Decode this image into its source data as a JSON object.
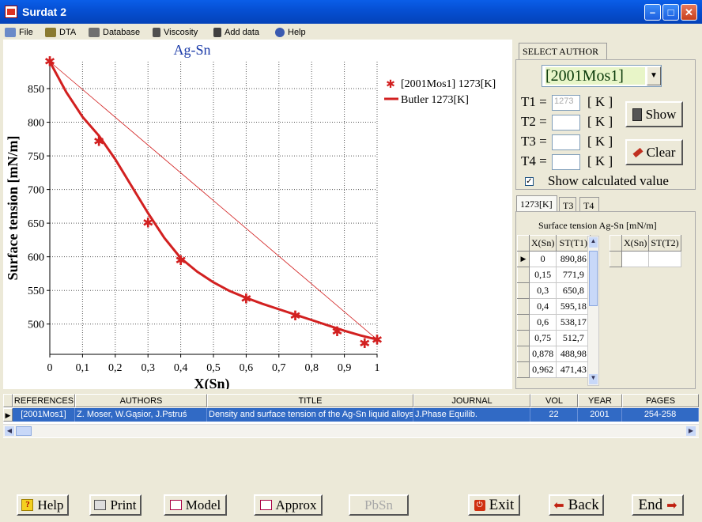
{
  "window": {
    "title": "Surdat 2"
  },
  "menu": [
    "File",
    "DTA",
    "Database",
    "Viscosity",
    "Add data",
    "Help"
  ],
  "chart_data": {
    "type": "line",
    "title": "Ag-Sn",
    "xlabel": "X(Sn)",
    "ylabel": "Surface tension [mN/m]",
    "xlim": [
      0,
      1
    ],
    "ylim": [
      455,
      890
    ],
    "x_ticks": [
      "0",
      "0,1",
      "0,2",
      "0,3",
      "0,4",
      "0,5",
      "0,6",
      "0,7",
      "0,8",
      "0,9",
      "1"
    ],
    "y_ticks": [
      "500",
      "550",
      "600",
      "650",
      "700",
      "750",
      "800",
      "850"
    ],
    "legend": [
      "[2001Mos1] 1273[K]",
      "Butler 1273[K]"
    ],
    "series": [
      {
        "name": "[2001Mos1] 1273[K]",
        "kind": "scatter",
        "color": "#d22020",
        "x": [
          0,
          0.15,
          0.3,
          0.4,
          0.6,
          0.75,
          0.878,
          0.962,
          1
        ],
        "y": [
          890.86,
          771.9,
          650.8,
          595.18,
          538.17,
          512.7,
          488.98,
          471.43,
          477
        ]
      },
      {
        "name": "Butler 1273[K]",
        "kind": "line",
        "color": "#d22020",
        "x": [
          0,
          0.05,
          0.1,
          0.15,
          0.2,
          0.25,
          0.3,
          0.35,
          0.4,
          0.45,
          0.5,
          0.55,
          0.6,
          0.65,
          0.7,
          0.75,
          0.8,
          0.85,
          0.9,
          0.95,
          1
        ],
        "y": [
          890,
          845,
          808,
          780,
          745,
          705,
          665,
          628,
          598,
          578,
          562,
          549,
          539,
          530,
          522,
          514,
          506,
          498,
          490,
          483,
          477
        ]
      },
      {
        "kind": "thin-line",
        "color": "#d22020",
        "x": [
          0,
          1
        ],
        "y": [
          890,
          477
        ]
      }
    ]
  },
  "select_author": {
    "tab_label": "SELECT AUTHOR",
    "author": "[2001Mos1]",
    "t1_label": "T1 =",
    "t1_value": "1273",
    "t2_label": "T2 =",
    "t3_label": "T3 =",
    "t4_label": "T4 =",
    "unit": "[ K ]",
    "show_label": "Show",
    "clear_label": "Clear",
    "show_calc_label": "Show calculated value"
  },
  "results": {
    "tabs": [
      "1273[K]",
      "T3",
      "T4"
    ],
    "caption": "Surface tension  Ag-Sn [mN/m]",
    "col1": "X(Sn)",
    "col2": "ST(T1)",
    "col3": "X(Sn)",
    "col4": "ST(T2)",
    "rows": [
      [
        "0",
        "890,86"
      ],
      [
        "0,15",
        "771,9"
      ],
      [
        "0,3",
        "650,8"
      ],
      [
        "0,4",
        "595,18"
      ],
      [
        "0,6",
        "538,17"
      ],
      [
        "0,75",
        "512,7"
      ],
      [
        "0,878",
        "488,98"
      ],
      [
        "0,962",
        "471,43"
      ]
    ]
  },
  "references": {
    "headers": [
      "REFERENCES",
      "AUTHORS",
      "TITLE",
      "JOURNAL",
      "VOL",
      "YEAR",
      "PAGES"
    ],
    "row": [
      "[2001Mos1]",
      "Z. Moser, W.Gąsior, J.Pstruś",
      "Density and surface tension of the Ag-Sn liquid alloys",
      "J.Phase Equilib.",
      "22",
      "2001",
      "254-258"
    ]
  },
  "buttons": {
    "help": "Help",
    "print": "Print",
    "model": "Model",
    "approx": "Approx",
    "pbsn": "PbSn",
    "exit": "Exit",
    "back": "Back",
    "end": "End"
  }
}
